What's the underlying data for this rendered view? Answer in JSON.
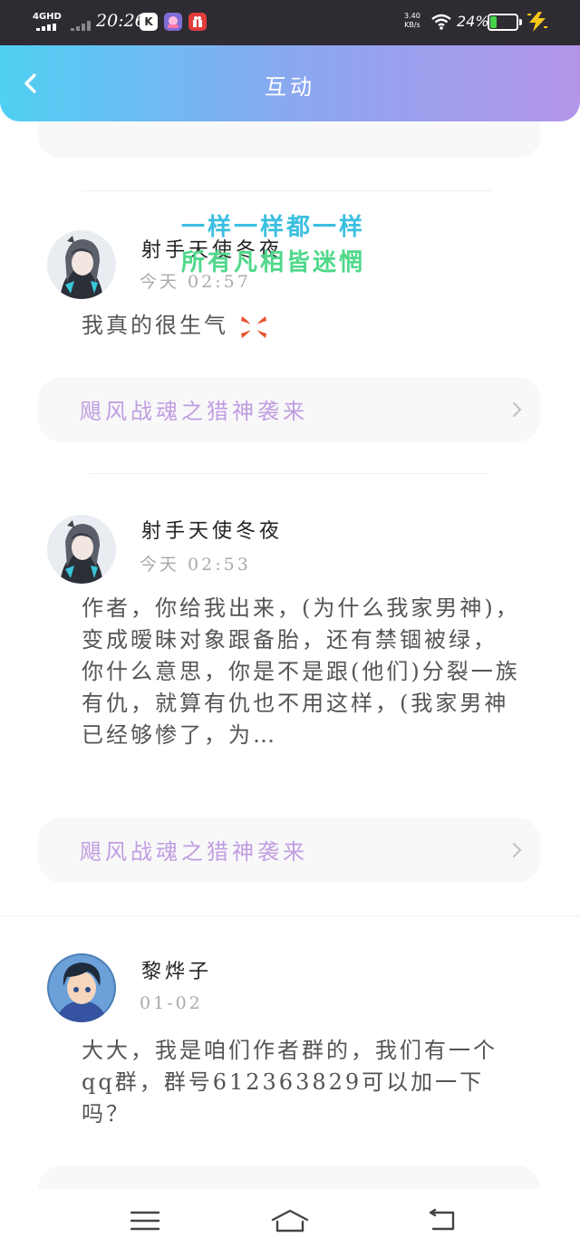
{
  "status_bar": {
    "network_type": "4GHD",
    "time": "20:26",
    "net_speed_value": "3.40",
    "net_speed_unit": "KB/s",
    "battery_text": "24%",
    "battery_level": 0.24,
    "apps": [
      "K",
      "",
      ""
    ]
  },
  "header": {
    "title": "互动"
  },
  "overlay": {
    "line1": "一样一样都一样",
    "line2": "所有凡相皆迷惘"
  },
  "comments": [
    {
      "username": "射手天使冬夜",
      "time": "今天 02:57",
      "text": "我真的很生气",
      "book": "飓风战魂之猎神袭来"
    },
    {
      "username": "射手天使冬夜",
      "time": "今天 02:53",
      "text": "作者，你给我出来，(为什么我家男神)，变成暧昧对象跟备胎，还有禁锢被绿，你什么意思，你是不是跟(他们)分裂一族有仇，就算有仇也不用这样，(我家男神已经够惨了，为…",
      "book": "飓风战魂之猎神袭来"
    },
    {
      "username": "黎烨子",
      "time": "01-02",
      "text": "大大，我是咱们作者群的，我们有一个qq群，群号612363829可以加一下吗？"
    }
  ],
  "colors": {
    "header_start": "#4fd0f2",
    "header_end": "#b495ea",
    "book_link": "#c09ee0",
    "battery": "#44d34a"
  },
  "icons": [
    "back-arrow-icon",
    "chevron-right-icon",
    "anger-emoji-icon",
    "menu-icon",
    "home-icon",
    "return-icon",
    "wifi-icon",
    "battery-icon",
    "charging-bolt-icon"
  ]
}
